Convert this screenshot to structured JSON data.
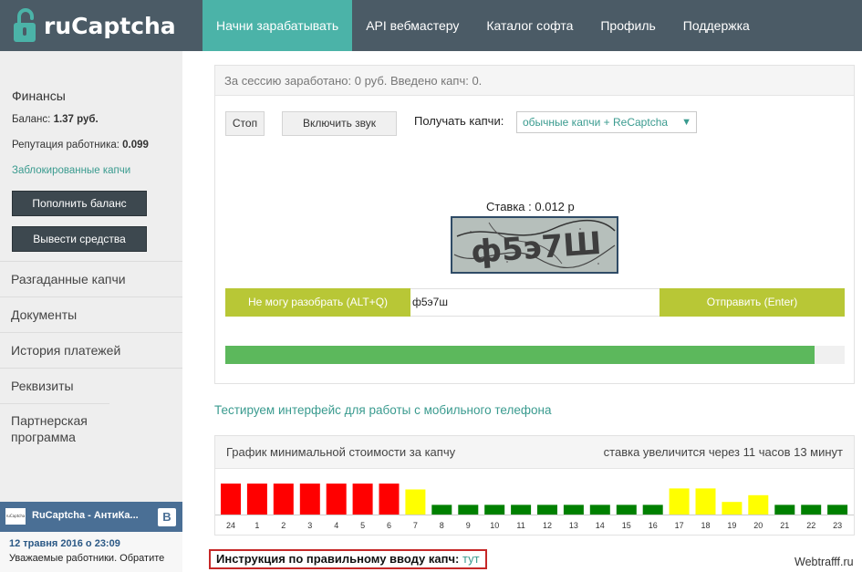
{
  "header": {
    "brand": "ruCaptcha",
    "nav": [
      {
        "label": "Начни зарабатывать",
        "active": true
      },
      {
        "label": "API вебмастеру",
        "active": false
      },
      {
        "label": "Каталог софта",
        "active": false
      },
      {
        "label": "Профиль",
        "active": false
      },
      {
        "label": "Поддержка",
        "active": false
      }
    ]
  },
  "sidebar": {
    "finance_title": "Финансы",
    "balance_label": "Баланс:",
    "balance_value": "1.37 руб.",
    "reputation_label": "Репутация работника:",
    "reputation_value": "0.099",
    "blocked_link": "Заблокированные капчи",
    "topup_button": "Пополнить баланс",
    "withdraw_button": "Вывести средства",
    "menu": [
      {
        "label": "Разгаданные капчи"
      },
      {
        "label": "Документы"
      },
      {
        "label": "История платежей"
      },
      {
        "label": "Реквизиты"
      },
      {
        "label": "Партнерская программа"
      }
    ]
  },
  "vk_widget": {
    "thumb_text": "ruCaptcha",
    "title": "RuCaptcha - АнтиКа...",
    "icon_letter": "В",
    "date": "12 травня 2016 о 23:09",
    "text": "Уважаемые работники. Обратите"
  },
  "work": {
    "session": "За сессию заработано: 0 руб. Введено капч: 0.",
    "stop_button": "Стоп",
    "sound_button": "Включить звук",
    "get_label": "Получать капчи:",
    "get_select": "обычные капчи + ReCaptcha",
    "rate_text": "Ставка : 0.012 р",
    "captcha_text": "ф5э7Ш",
    "cant_button": "Не могу разобрать  (ALT+Q)",
    "answer_value": "ф5э7ш",
    "send_button": "Отправить (Enter)",
    "progress": 0.951
  },
  "mobile_link": "Тестируем интерфейс для работы с мобильного телефона",
  "chart_panel": {
    "title": "График минимальной стоимости за капчу",
    "note": "ставка увеличится через 11 часов 13 минут"
  },
  "chart_data": {
    "type": "bar",
    "categories": [
      "24",
      "1",
      "2",
      "3",
      "4",
      "5",
      "6",
      "7",
      "8",
      "9",
      "10",
      "11",
      "12",
      "13",
      "14",
      "15",
      "16",
      "17",
      "18",
      "19",
      "20",
      "21",
      "22",
      "23"
    ],
    "values": [
      32,
      32,
      32,
      32,
      32,
      32,
      32,
      26,
      10,
      10,
      10,
      10,
      10,
      10,
      10,
      10,
      10,
      27,
      27,
      13,
      20,
      10,
      10,
      10
    ],
    "colors": [
      "#ff0000",
      "#ff0000",
      "#ff0000",
      "#ff0000",
      "#ff0000",
      "#ff0000",
      "#ff0000",
      "#ffff00",
      "#008000",
      "#008000",
      "#008000",
      "#008000",
      "#008000",
      "#008000",
      "#008000",
      "#008000",
      "#008000",
      "#ffff00",
      "#ffff00",
      "#ffff00",
      "#ffff00",
      "#008000",
      "#008000",
      "#008000"
    ],
    "ylim": [
      0,
      34
    ]
  },
  "instruction": {
    "label": "Инструкция по правильному вводу капч:",
    "link": "тут"
  },
  "watermark": "Webtrafff.ru"
}
